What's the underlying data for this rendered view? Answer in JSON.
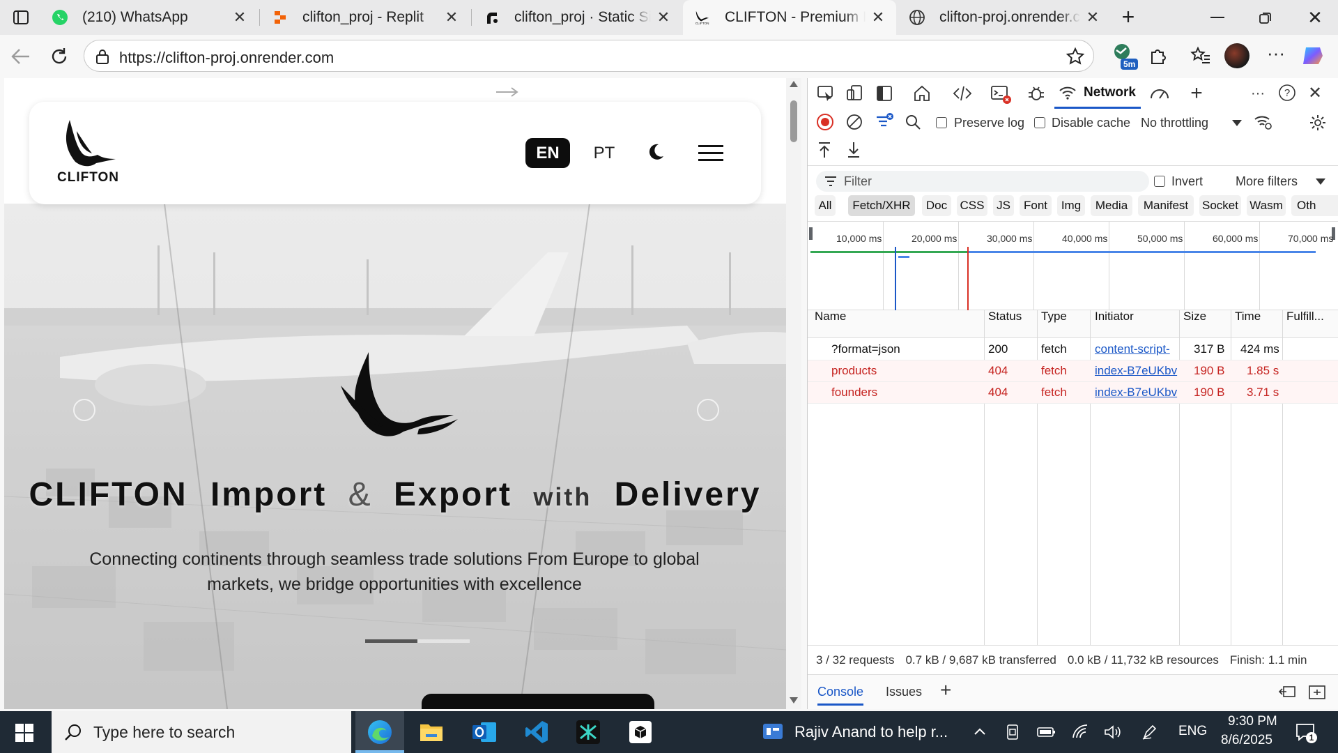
{
  "tabs": [
    {
      "title": "(210) WhatsApp",
      "icon": "whatsapp-icon"
    },
    {
      "title": "clifton_proj - Replit",
      "icon": "replit-icon"
    },
    {
      "title": "clifton_proj · Static Site · R",
      "icon": "render-icon"
    },
    {
      "title": "CLIFTON - Premium Import",
      "icon": "clifton-eagle-icon",
      "active": true
    },
    {
      "title": "clifton-proj.onrender.com/",
      "icon": "globe-icon"
    }
  ],
  "address": {
    "url": "https://clifton-proj.onrender.com"
  },
  "profile": {
    "badge": "5m"
  },
  "site": {
    "logo_text": "CLIFTON",
    "lang_en": "EN",
    "lang_pt": "PT",
    "hero_title": {
      "w1": "CLIFTON",
      "w2": "Import",
      "amp": "&",
      "w3": "Export",
      "w4": "with",
      "w5": "Delivery"
    },
    "hero_subtitle": "Connecting continents through seamless trade solutions From Europe to global markets, we bridge opportunities with excellence",
    "slide_progress": 0.5
  },
  "devtools": {
    "active_panel": "Network",
    "preserve_log": "Preserve log",
    "disable_cache": "Disable cache",
    "throttling": "No throttling",
    "filter_placeholder": "Filter",
    "invert": "Invert",
    "more_filters": "More filters",
    "type_filters": [
      "All",
      "Fetch/XHR",
      "Doc",
      "CSS",
      "JS",
      "Font",
      "Img",
      "Media",
      "Manifest",
      "Socket",
      "Wasm",
      "Oth"
    ],
    "selected_filter": "Fetch/XHR",
    "timeline_ticks": [
      "10,000 ms",
      "20,000 ms",
      "30,000 ms",
      "40,000 ms",
      "50,000 ms",
      "60,000 ms",
      "70,000 ms"
    ],
    "columns": [
      "Name",
      "Status",
      "Type",
      "Initiator",
      "Size",
      "Time",
      "Fulfill..."
    ],
    "rows": [
      {
        "name": "?format=json",
        "status": "200",
        "type": "fetch",
        "initiator": "content-script-",
        "size": "317 B",
        "time": "424 ms",
        "error": false
      },
      {
        "name": "products",
        "status": "404",
        "type": "fetch",
        "initiator": "index-B7eUKbv",
        "size": "190 B",
        "time": "1.85 s",
        "error": true
      },
      {
        "name": "founders",
        "status": "404",
        "type": "fetch",
        "initiator": "index-B7eUKbv",
        "size": "190 B",
        "time": "3.71 s",
        "error": true
      }
    ],
    "summary": {
      "requests": "3 / 32 requests",
      "transferred": "0.7 kB / 9,687 kB transferred",
      "resources": "0.0 kB / 11,732 kB resources",
      "finish": "Finish: 1.1 min"
    },
    "drawer_tabs": [
      "Console",
      "Issues"
    ]
  },
  "taskbar": {
    "search_placeholder": "Type here to search",
    "notification": "Rajiv Anand to help r...",
    "language": "ENG",
    "time": "9:30 PM",
    "date": "8/6/2025",
    "notif_count": "1"
  },
  "colors": {
    "accent": "#1a57c7",
    "error": "#c5221f",
    "record": "#d93025",
    "taskbar": "#1f2a35"
  }
}
